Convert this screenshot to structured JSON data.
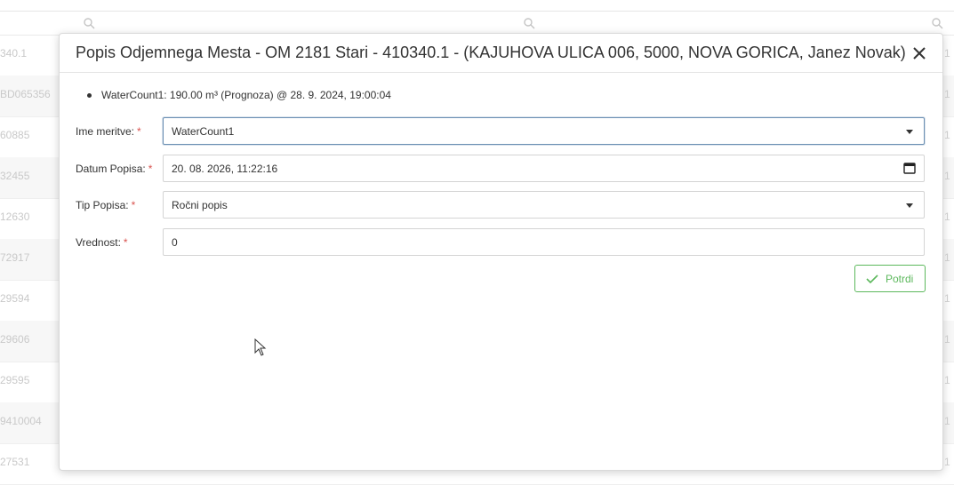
{
  "background": {
    "left_cells": [
      "340.1",
      "BD065356",
      "60885",
      "32455",
      "12630",
      "72917",
      "29594",
      "29606",
      "29595",
      "9410004",
      "27531"
    ],
    "right_cell": "1"
  },
  "modal": {
    "title": "Popis Odjemnega Mesta - OM 2181 Stari - 410340.1 - (KAJUHOVA ULICA 006, 5000, NOVA GORICA, Janez Novak)",
    "close_icon": "close-icon",
    "info_items": [
      "WaterCount1: 190.00 m³ (Prognoza) @ 28. 9. 2024, 19:00:04"
    ],
    "form": {
      "measurement": {
        "label": "Ime meritve:",
        "value": "WaterCount1"
      },
      "date": {
        "label": "Datum Popisa:",
        "value": "20. 08. 2026, 11:22:16"
      },
      "type": {
        "label": "Tip Popisa:",
        "value": "Ročni popis"
      },
      "amount": {
        "label": "Vrednost:",
        "value": "0"
      },
      "required_mark": "*"
    },
    "confirm_label": "Potrdi"
  },
  "colors": {
    "accent_green": "#5cb85c",
    "required_red": "#d9534f",
    "focus_border": "#6b8fb3"
  }
}
